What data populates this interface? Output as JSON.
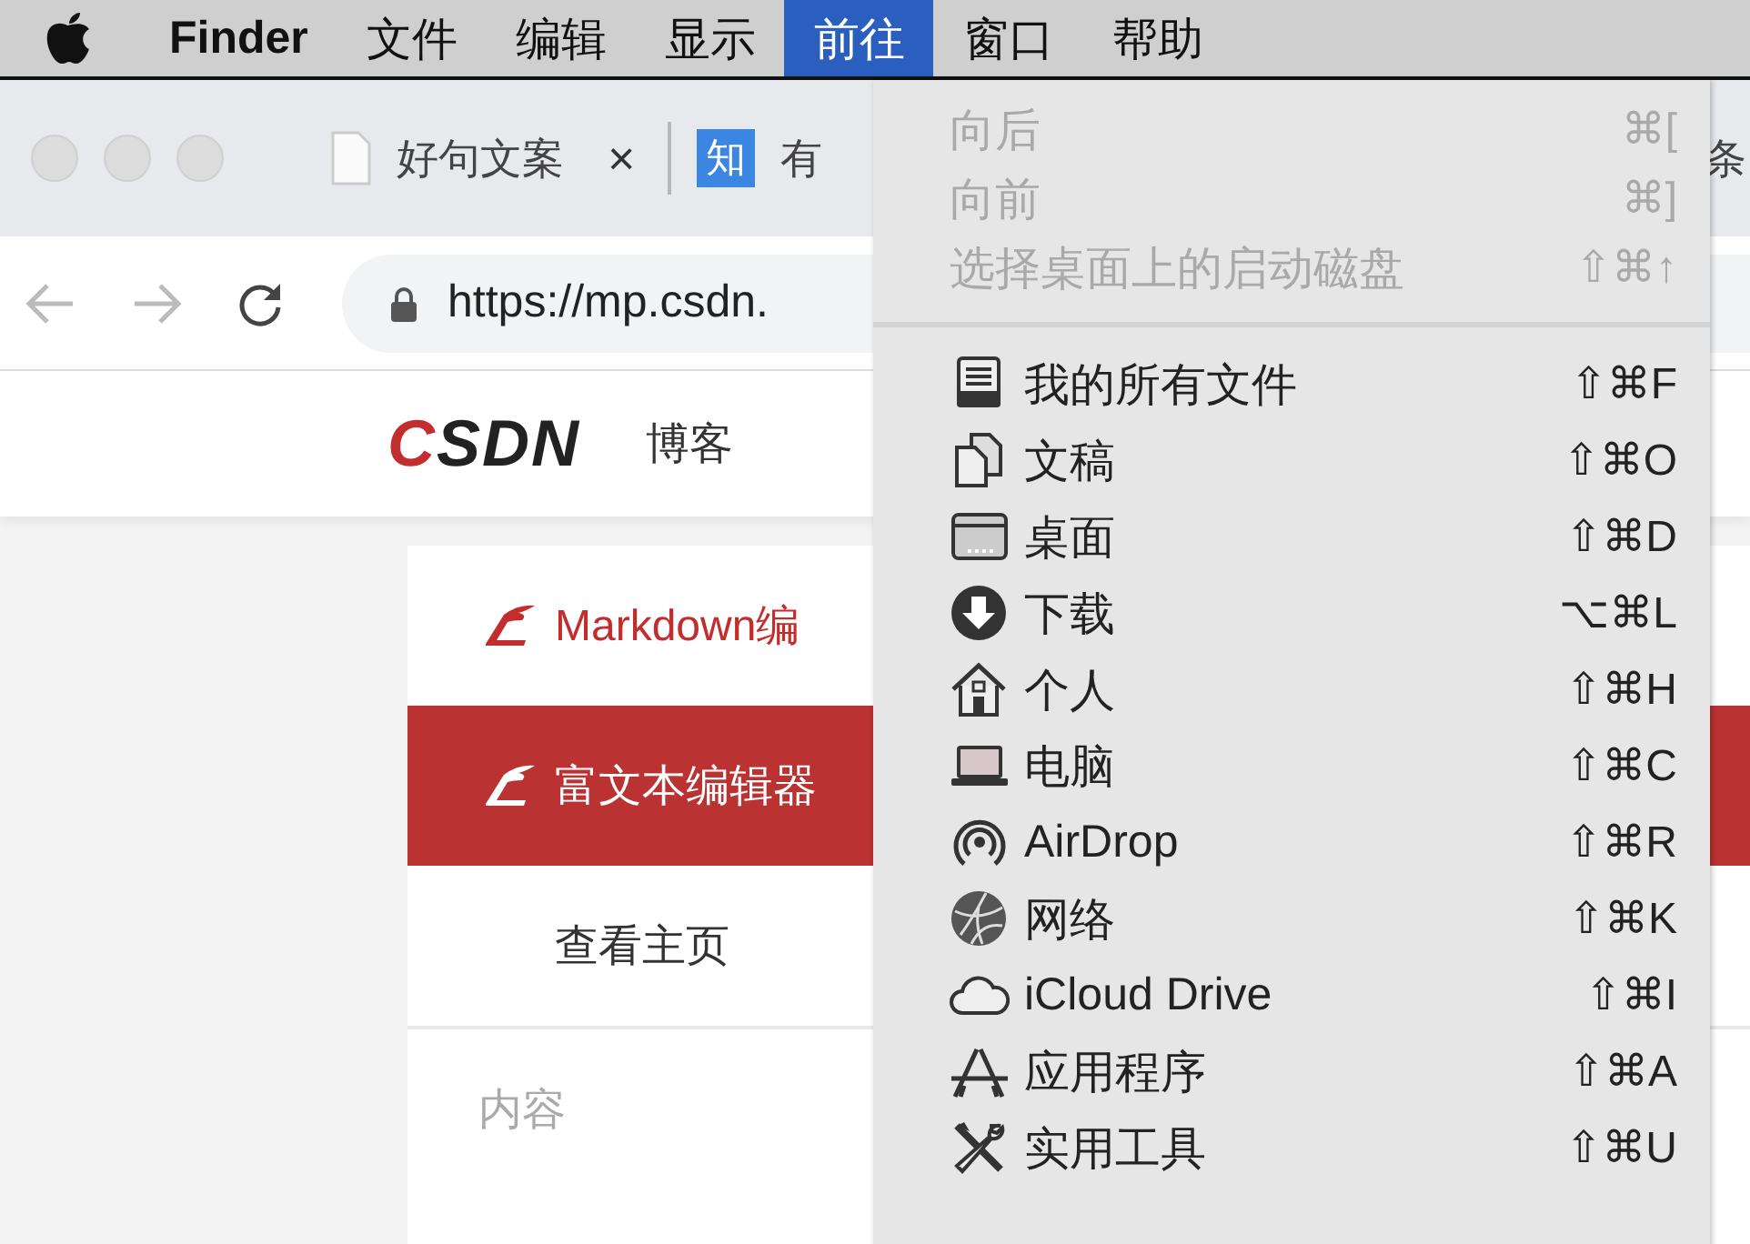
{
  "menubar": {
    "items": [
      {
        "kind": "apple",
        "selected": false
      },
      {
        "kind": "app",
        "label": "Finder",
        "selected": false
      },
      {
        "kind": "menu",
        "label": "文件",
        "selected": false
      },
      {
        "kind": "menu",
        "label": "编辑",
        "selected": false
      },
      {
        "kind": "menu",
        "label": "显示",
        "selected": false
      },
      {
        "kind": "menu",
        "label": "前往",
        "selected": true
      },
      {
        "kind": "menu",
        "label": "窗口",
        "selected": false
      },
      {
        "kind": "menu",
        "label": "帮助",
        "selected": false
      }
    ]
  },
  "browser": {
    "tabs": [
      {
        "kind": "document",
        "title": "好句文案",
        "close": "×"
      },
      {
        "kind": "badge",
        "badge": "知",
        "title": "有"
      },
      {
        "title": "条"
      }
    ],
    "url": "https://mp.csdn."
  },
  "site": {
    "logo": "CSDN",
    "nav": [
      {
        "label": "博客"
      }
    ]
  },
  "sidebar": {
    "items": [
      {
        "kind": "quill",
        "label": "Markdown编",
        "selected": false
      },
      {
        "kind": "quill",
        "label": "富文本编辑器",
        "selected": true
      },
      {
        "kind": "plain",
        "label": "查看主页",
        "selected": false
      }
    ],
    "section": "内容"
  },
  "go_menu": {
    "sections": [
      [
        {
          "label": "向后",
          "shortcut": "⌘[",
          "disabled": true,
          "kind": "plain"
        },
        {
          "label": "向前",
          "shortcut": "⌘]",
          "disabled": true,
          "kind": "plain"
        },
        {
          "label": "选择桌面上的启动磁盘",
          "shortcut": "⇧⌘↑",
          "disabled": true,
          "kind": "plain"
        }
      ],
      [
        {
          "label": "我的所有文件",
          "shortcut": "⇧⌘F",
          "disabled": false,
          "kind": "tray"
        },
        {
          "label": "文稿",
          "shortcut": "⇧⌘O",
          "disabled": false,
          "kind": "docs"
        },
        {
          "label": "桌面",
          "shortcut": "⇧⌘D",
          "disabled": false,
          "kind": "desktop"
        },
        {
          "label": "下载",
          "shortcut": "⌥⌘L",
          "disabled": false,
          "kind": "download"
        },
        {
          "label": "个人",
          "shortcut": "⇧⌘H",
          "disabled": false,
          "kind": "home"
        },
        {
          "label": "电脑",
          "shortcut": "⇧⌘C",
          "disabled": false,
          "kind": "laptop"
        },
        {
          "label": "AirDrop",
          "shortcut": "⇧⌘R",
          "disabled": false,
          "kind": "airdrop"
        },
        {
          "label": "网络",
          "shortcut": "⇧⌘K",
          "disabled": false,
          "kind": "network"
        },
        {
          "label": "iCloud Drive",
          "shortcut": "⇧⌘I",
          "disabled": false,
          "kind": "cloud"
        },
        {
          "label": "应用程序",
          "shortcut": "⇧⌘A",
          "disabled": false,
          "kind": "apps"
        },
        {
          "label": "实用工具",
          "shortcut": "⇧⌘U",
          "disabled": false,
          "kind": "tools"
        }
      ]
    ]
  }
}
